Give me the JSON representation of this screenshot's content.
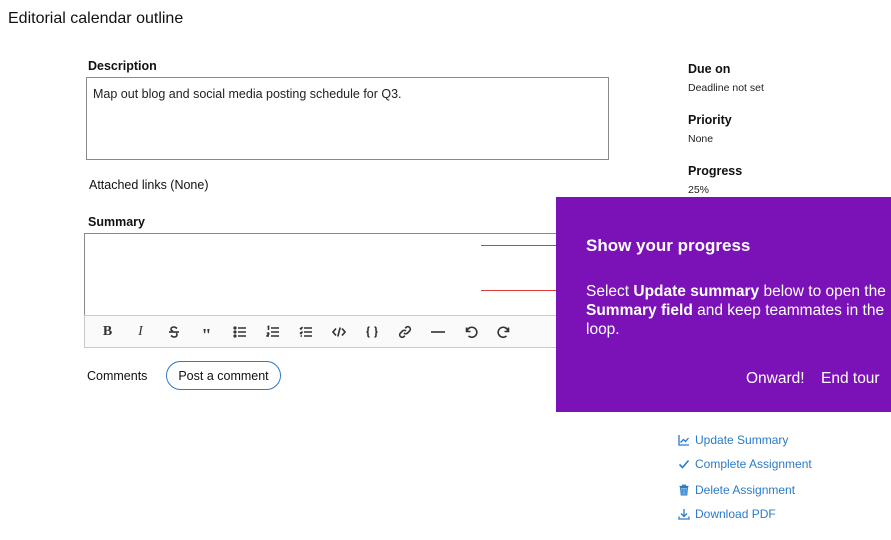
{
  "page": {
    "title": "Editorial calendar outline"
  },
  "description": {
    "label": "Description",
    "value": "Map out blog and social media posting schedule for Q3."
  },
  "attached_links": "Attached links (None)",
  "summary": {
    "label": "Summary",
    "value": "",
    "toolbar": [
      "bold-icon",
      "italic-icon",
      "strikethrough-icon",
      "quote-icon",
      "bullet-list-icon",
      "numbered-list-icon",
      "checklist-icon",
      "code-icon",
      "code-block-icon",
      "link-icon",
      "horizontal-rule-icon",
      "undo-icon",
      "redo-icon"
    ]
  },
  "comments": {
    "label": "Comments",
    "post_button": "Post a comment"
  },
  "sidebar": {
    "due_label": "Due on",
    "due_value": "Deadline not set",
    "priority_label": "Priority",
    "priority_value": "None",
    "progress_label": "Progress",
    "progress_value": "25%"
  },
  "actions": {
    "update_summary": "Update Summary",
    "complete_assignment": "Complete Assignment",
    "delete_assignment": "Delete Assignment",
    "download_pdf": "Download PDF"
  },
  "tour": {
    "title": "Show your progress",
    "body_1": "Select ",
    "body_bold_1": "Update summary",
    "body_2": " below to open the ",
    "body_bold_2": "Summary field",
    "body_3": " and keep teammates in the loop.",
    "onward_button": "Onward!",
    "end_button": "End tour",
    "background_color": "#7b12b8",
    "pointer_color": "#e03a3a"
  },
  "colors": {
    "accent": "#2a7bc8"
  }
}
